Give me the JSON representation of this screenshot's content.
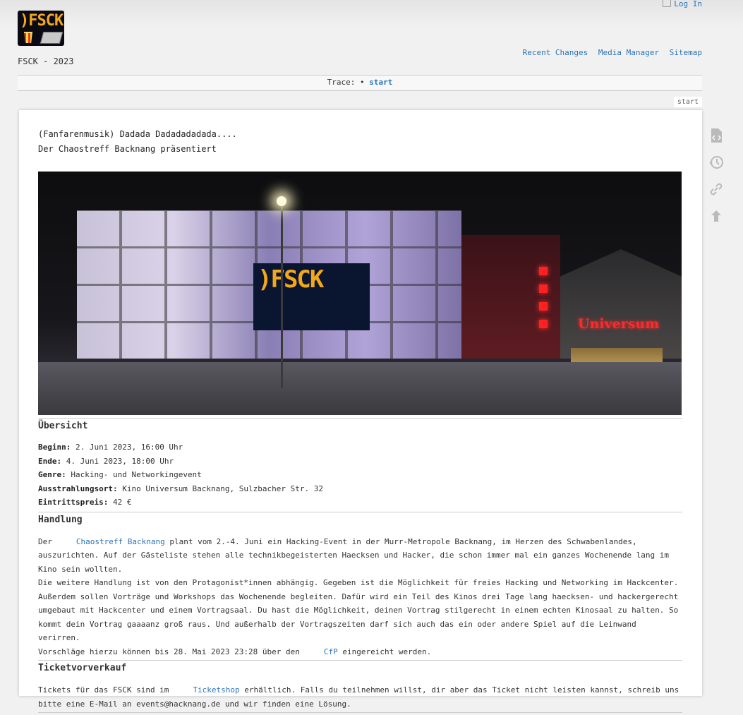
{
  "site": {
    "title": "FSCK - 2023",
    "logo_text": ")FSCK",
    "login_label": "Log In",
    "tools": [
      "Recent Changes",
      "Media Manager",
      "Sitemap"
    ]
  },
  "trace": {
    "label": "Trace:",
    "bullet": "•",
    "page": "start"
  },
  "page_id": "start",
  "intro": {
    "line1": "(Fanfarenmusik) Dadada Dadadadadada....",
    "line2": "Der Chaostreff Backnang präsentiert"
  },
  "hero": {
    "screen_text": ")FSCK",
    "sign_text": "Universum"
  },
  "overview": {
    "heading": "Übersicht",
    "items": [
      {
        "key": "Beginn:",
        "value": "2. Juni 2023, 16:00 Uhr"
      },
      {
        "key": "Ende:",
        "value": "4. Juni 2023, 18:00 Uhr"
      },
      {
        "key": "Genre:",
        "value": "Hacking- und Networkingevent"
      },
      {
        "key": "Ausstrahlungsort:",
        "value": "Kino Universum Backnang, Sulzbacher Str. 32"
      },
      {
        "key": "Eintrittspreis:",
        "value": "42 €"
      }
    ]
  },
  "handlung": {
    "heading": "Handlung",
    "p1_pre": "Der",
    "p1_link": "Chaostreff Backnang",
    "p1_post": "plant vom 2.-4. Juni ein Hacking-Event in der Murr-Metropole Backnang, im Herzen des Schwabenlandes, auszurichten. Auf der Gästeliste stehen alle technikbegeisterten Haecksen und Hacker, die schon immer mal ein ganzes Wochenende lang im Kino sein wollten.",
    "p2": "Die weitere Handlung ist von den Protagonist*innen abhängig. Gegeben ist die Möglichkeit für freies Hacking und Networking im Hackcenter. Außerdem sollen Vorträge und Workshops das Wochenende begleiten. Dafür wird ein Teil des Kinos drei Tage lang haecksen- und hackergerecht umgebaut mit Hackcenter und einem Vortragsaal. Du hast die Möglichkeit, deinen Vortrag stilgerecht in einem echten Kinosaal zu halten. So kommt dein Vortrag gaaaanz groß raus. Und außerhalb der Vortragszeiten darf sich auch das ein oder andere Spiel auf die Leinwand verirren.",
    "p3_pre": "Vorschläge hierzu können bis 28. Mai 2023 23:28 über den",
    "p3_link": "CfP",
    "p3_post": "eingereicht werden."
  },
  "ticket": {
    "heading": "Ticketvorverkauf",
    "pre": "Tickets für das FSCK sind im",
    "link": "Ticketshop",
    "post": "erhältlich. Falls du teilnehmen willst, dir aber das Ticket nicht leisten kannst, schreib uns bitte eine E-Mail an events@hacknang.de und wir finden eine Lösung."
  },
  "page_tools": [
    "show-source-icon",
    "old-revisions-icon",
    "backlinks-icon",
    "back-to-top-icon"
  ]
}
